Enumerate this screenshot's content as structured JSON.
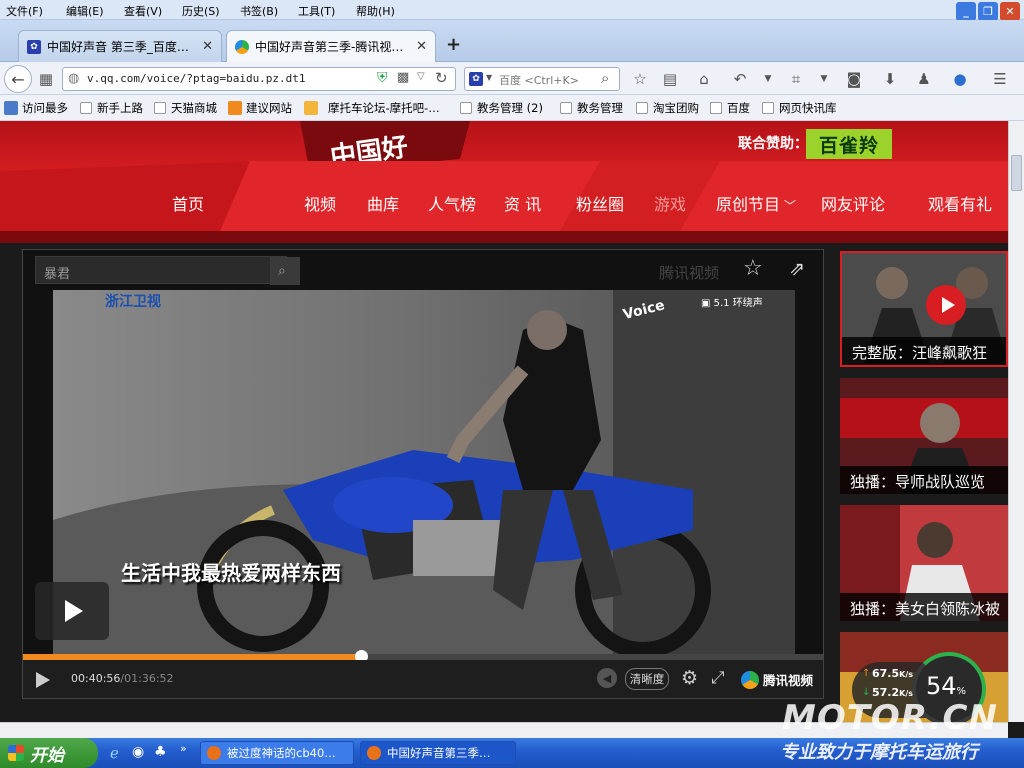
{
  "menubar": {
    "items": [
      "文件(F)",
      "编辑(E)",
      "查看(V)",
      "历史(S)",
      "书签(B)",
      "工具(T)",
      "帮助(H)"
    ]
  },
  "tabs": [
    {
      "label": "中国好声音 第三季_百度…",
      "active": false
    },
    {
      "label": "中国好声音第三季-腾讯视…",
      "active": true
    }
  ],
  "new_tab_icon": "plus-icon",
  "navbar": {
    "url": "v.qq.com/voice/?ptag=baidu.pz.dt1",
    "search_engine": "百度",
    "search_placeholder": "百度 <Ctrl+K>"
  },
  "bookmarks": [
    {
      "label": "访问最多",
      "icon": "most-visited-icon"
    },
    {
      "label": "新手上路",
      "icon": "page-icon"
    },
    {
      "label": "天猫商城",
      "icon": "page-icon"
    },
    {
      "label": "建议网站",
      "icon": "suggest-icon"
    },
    {
      "label": "摩托车论坛-摩托吧-…",
      "icon": "forum-icon"
    },
    {
      "label": "教务管理 (2)",
      "icon": "page-icon"
    },
    {
      "label": "教务管理",
      "icon": "page-icon"
    },
    {
      "label": "淘宝团购",
      "icon": "page-icon"
    },
    {
      "label": "百度",
      "icon": "page-icon"
    },
    {
      "label": "网页快讯库",
      "icon": "page-icon"
    }
  ],
  "site": {
    "sponsor_label": "联合赞助：",
    "sponsor_brand": "百雀羚",
    "nav": [
      "首页",
      "视频",
      "曲库",
      "人气榜",
      "资 讯",
      "粉丝圈",
      "游戏",
      "原创节目",
      "网友评论",
      "观看有礼"
    ]
  },
  "player": {
    "search_value": "暴君",
    "subtitle": "生活中我最热爱两样东西",
    "time_current": "00:40:56",
    "time_total": "/01:36:52",
    "progress": 0.4226,
    "quality_label": "清晰度",
    "brand": "腾讯视频",
    "watermark_top_right": "腾讯视频"
  },
  "sidebar_cards": [
    {
      "caption": "完整版：汪峰飙歌狂"
    },
    {
      "caption": "独播：导师战队巡览"
    },
    {
      "caption": "独播：美女白领陈冰被"
    },
    {
      "caption": ""
    }
  ],
  "speed_widget": {
    "upload": "67.5",
    "download": "57.2",
    "unit": "K/s",
    "percent": "54",
    "percent_sign": "%"
  },
  "taskbar": {
    "start_label": "开始",
    "tasks": [
      "被过度神话的cb40…",
      "中国好声音第三季…"
    ]
  },
  "watermark": {
    "brand": "MOTOR.CN",
    "slogan": "专业致力于摩托车运旅行"
  },
  "colors": {
    "header_red": "#d81e22",
    "progress_orange": "#f08a1e",
    "sponsor_green": "#9bd22c"
  }
}
